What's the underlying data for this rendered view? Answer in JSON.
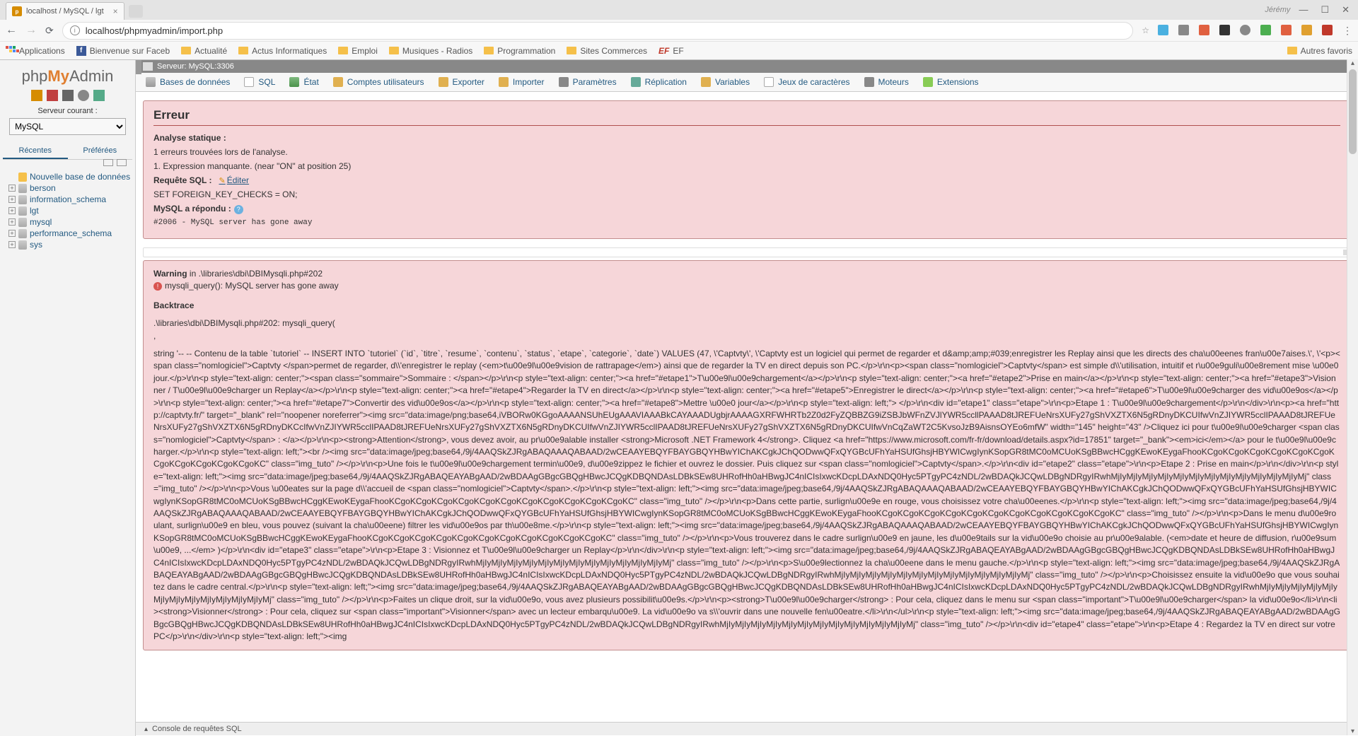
{
  "browser": {
    "tab_title": "localhost / MySQL / lgt",
    "user": "Jérémy",
    "url": "localhost/phpmyadmin/import.php"
  },
  "bookmarks": {
    "apps": "Applications",
    "fb": "Bienvenue sur Faceb",
    "actu": "Actualité",
    "actuinfo": "Actus Informatiques",
    "emploi": "Emploi",
    "musique": "Musiques - Radios",
    "prog": "Programmation",
    "sites": "Sites Commerces",
    "ef": "EF",
    "other": "Autres favoris"
  },
  "sidebar": {
    "server_label": "Serveur courant :",
    "server_value": "MySQL",
    "tab_recent": "Récentes",
    "tab_pref": "Préférées",
    "new_db": "Nouvelle base de données",
    "dbs": [
      "berson",
      "information_schema",
      "lgt",
      "mysql",
      "performance_schema",
      "sys"
    ]
  },
  "topbar": {
    "server": "Serveur: MySQL:3306"
  },
  "menu": {
    "db": "Bases de données",
    "sql": "SQL",
    "etat": "État",
    "users": "Comptes utilisateurs",
    "export": "Exporter",
    "import": "Importer",
    "param": "Paramètres",
    "repl": "Réplication",
    "vars": "Variables",
    "charset": "Jeux de caractères",
    "engine": "Moteurs",
    "ext": "Extensions"
  },
  "error": {
    "title": "Erreur",
    "analysis": "Analyse statique :",
    "found": "1 erreurs trouvées lors de l'analyse.",
    "item": "Expression manquante. (near \"ON\" at position 25)",
    "sql_label": "Requête SQL :",
    "edit": "Éditer",
    "sql": "SET FOREIGN_KEY_CHECKS = ON;",
    "mysql_label": "MySQL a répondu :",
    "code": "#2006 - MySQL server has gone away"
  },
  "warning": {
    "label": "Warning",
    "in": "in .\\libraries\\dbi\\DBIMysqli.php#202",
    "msg": "mysqli_query(): MySQL server has gone away",
    "bt_label": "Backtrace",
    "bt_line": ".\\libraries\\dbi\\DBIMysqli.php#202: mysqli_query(",
    "comma": ",",
    "dump": "string '-- -- Contenu de la table `tutoriel` -- INSERT INTO `tutoriel` (`id`, `titre`, `resume`, `contenu`, `status`, `etape`, `categorie`, `date`) VALUES (47, \\'Captvty\\', \\'Captvty est un logiciel qui permet de regarder et d&amp;amp;#039;enregistrer les Replay ainsi que les directs des cha\\u00eenes fran\\u00e7aises.\\', \\'<p><span class=\"nomlogiciel\">Captvty </span>permet de regarder, d\\\\'enregistrer le replay (<em>t\\u00e9l\\u00e9vision de rattrapage</em>) ainsi que de regarder la TV en direct depuis son PC.</p>\\r\\n<p><span class=\"nomlogiciel\">Captvty</span> est simple d\\\\'utilisation, intuitif et r\\u00e9guli\\u00e8rement mise \\u00e0 jour.</p>\\r\\n<p style=\"text-align: center;\"><span class=\"sommaire\">Sommaire : </span></p>\\r\\n<p style=\"text-align: center;\"><a href=\"#etape1\">T\\u00e9l\\u00e9chargement</a></p>\\r\\n<p style=\"text-align: center;\"><a href=\"#etape2\">Prise en main</a></p>\\r\\n<p style=\"text-align: center;\"><a href=\"#etape3\">Visionner / T\\u00e9l\\u00e9charger un Replay</a></p>\\r\\n<p style=\"text-align: center;\"><a href=\"#etape4\">Regarder la TV en direct</a></p>\\r\\n<p style=\"text-align: center;\"><a href=\"#etape5\">Enregistrer le direct</a></p>\\r\\n<p style=\"text-align: center;\"><a href=\"#etape6\">T\\u00e9l\\u00e9charger des vid\\u00e9os</a></p>\\r\\n<p style=\"text-align: center;\"><a href=\"#etape7\">Convertir des vid\\u00e9os</a></p>\\r\\n<p style=\"text-align: center;\"><a href=\"#etape8\">Mettre \\u00e0 jour</a></p>\\r\\n<p style=\"text-align: left;\"> </p>\\r\\n<div id=\"etape1\" class=\"etape\">\\r\\n<p>Etape 1 : T\\u00e9l\\u00e9chargement</p>\\r\\n</div>\\r\\n<p><a href=\"http://captvty.fr/\" target=\"_blank\" rel=\"noopener noreferrer\"><img src=\"data:image/png;base64,iVBORw0KGgoAAAANSUhEUgAAAVIAAABkCAYAAADUgbjrAAAAGXRFWHRTb2Z0d2FyZQBBZG9iZSBJbWFnZVJlYWR5ccllPAAAD8tJREFUeNrsXUFy27gShVXZTX6N5gRDnyDKCUIfwVnZJIYWR5cclIPAAAD8tJREFUeNrsXUFy27gShVXZTX6N5gRDnyDKCcIfwVnZJIYWR5cclIPAAD8tJREFUeNrsXUFy27gShVXZTX6N5gRDnyDKCUIfwVnZJIYWR5cclIPAAD8tJREFUeNrsXUFy27gShVXZTX6N5gRDnyDKCUIfwVnCqZaWT2C5KvsoJzB9AisnsOYEo6mfW\" width=\"145\" height=\"43\" />Cliquez ici pour t\\u00e9l\\u00e9charger <span class=\"nomlogiciel\">Captvty</span> : </a></p>\\r\\n<p><strong>Attention</strong>, vous devez avoir, au pr\\u00e9alable installer <strong>Microsoft .NET Framework 4</strong>. Cliquez <a href=\"https://www.microsoft.com/fr-fr/download/details.aspx?id=17851\" target=\"_bank\"><em>ici</em></a> pour le t\\u00e9l\\u00e9charger.</p>\\r\\n<p style=\"text-align: left;\"><br /><img src=\"data:image/jpeg;base64,/9j/4AAQSkZJRgABAQAAAQABAAD/2wCEAAYEBQYFBAYGBQYHBwYIChAKCgkJChQODwwQFxQYGBcUFhYaHSUfGhsjHBYWICwgIynKSopGR8tMC0oMCUoKSgBBwcHCggKEwoKEygaFhooKCgoKCgoKCgoKCgoKCgoKCgoKCgoKCgoKCgoKCgoKCgoKC\" class=\"img_tuto\" /></p>\\r\\n<p>Une fois le t\\u00e9l\\u00e9chargement termin\\u00e9, d\\u00e9zippez le fichier et ouvrez le dossier. Puis cliquez sur <span class=\"nomlogiciel\">Captvty</span>.</p>\\r\\n<div id=\"etape2\" class=\"etape\">\\r\\n<p>Etape 2 : Prise en main</p>\\r\\n</div>\\r\\n<p style=\"text-align: left;\"><img src=\"data:image/jpeg;base64,/9j/4AAQSkZJRgABAQEAYABgAAD/2wBDAAgGBgcGBQgHBwcJCQgKDBQNDAsLDBkSEw8UHRofHh0aHBwgJC4nICIsIxwcKDcpLDAxNDQ0Hyc5PTgyPC4zNDL/2wBDAQkJCQwLDBgNDRgyIRwhMjIyMjIyMjIyMjIyMjIyMjIyMjIyMjIyMjIyMjIyMjIyMjIyMj\" class=\"img_tuto\" /></p>\\r\\n<p>Vous \\u00eates sur la page d\\\\'accueil de <span class=\"nomlogiciel\">Captvty</span>.</p>\\r\\n<p style=\"text-align: left;\"><img src=\"data:image/jpeg;base64,/9j/4AAQSkZJRgABAQAAAQABAAD/2wCEAAYEBQYFBAYGBQYHBwYIChAKCgkJChQODwwQFxQYGBcUFhYaHSUfGhsjHBYWICwgIynKSopGR8tMC0oMCUoKSgBBwcHCggKEwoKEygaFhooKCgoKCgoKCgoKCgoKCgoKCgoKCgoKCgoKCgoKCgoKCgoKC\" class=\"img_tuto\" /></p>\\r\\n<p>Dans cette partie, surlign\\u00e9e en rouge, vous choisissez votre cha\\u00eenes.</p>\\r\\n<p style=\"text-align: left;\"><img src=\"data:image/jpeg;base64,/9j/4AAQSkZJRgABAQAAAQABAAD/2wCEAAYEBQYFBAYGBQYHBwYIChAKCgkJChQODwwQFxQYGBcUFhYaHSUfGhsjHBYWICwgIynKSopGR8tMC0oMCUoKSgBBwcHCggKEwoKEygaFhooKCgoKCgoKCgoKCgoKCgoKCgoKCgoKCgoKCgoKCgoKCgoKC\" class=\"img_tuto\" /></p>\\r\\n<p>Dans le menu d\\u00e9roulant, surlign\\u00e9 en bleu, vous pouvez (suivant la cha\\u00eene) filtrer les vid\\u00e9os par th\\u00e8me.</p>\\r\\n<p style=\"text-align: left;\"><img src=\"data:image/jpeg;base64,/9j/4AAQSkZJRgABAQAAAQABAAD/2wCEAAYEBQYFBAYGBQYHBwYIChAKCgkJChQODwwQFxQYGBcUFhYaHSUfGhsjHBYWICwgIynKSopGR8tMC0oMCUoKSgBBwcHCggKEwoKEygaFhooKCgoKCgoKCgoKCgoKCgoKCgoKCgoKCgoKCgoKCgoKCgoKC\" class=\"img_tuto\" /></p>\\r\\n<p>Vous trouverez dans le cadre surlign\\u00e9 en jaune, les d\\u00e9tails sur la vid\\u00e9o choisie au pr\\u00e9alable. (<em>date et heure de diffusion, r\\u00e9sum\\u00e9, ...</em> )</p>\\r\\n<div id=\"etape3\" class=\"etape\">\\r\\n<p>Etape 3 : Visionnez et T\\u00e9l\\u00e9charger un Replay</p>\\r\\n</div>\\r\\n<p style=\"text-align: left;\"><img src=\"data:image/jpeg;base64,/9j/4AAQSkZJRgABAQEAYABgAAD/2wBDAAgGBgcGBQgHBwcJCQgKDBQNDAsLDBkSEw8UHRofHh0aHBwgJC4nICIsIxwcKDcpLDAxNDQ0Hyc5PTgyPC4zNDL/2wBDAQkJCQwLDBgNDRgyIRwhMjIyMjIyMjIyMjIyMjIyMjIyMjIyMjIyMjIyMjIyMjIyMjIyMj\" class=\"img_tuto\" /></p>\\r\\n<p>S\\u00e9lectionnez la cha\\u00eene dans le menu gauche.</p>\\r\\n<p style=\"text-align: left;\"><img src=\"data:image/jpeg;base64,/9j/4AAQSkZJRgABAQEAYABgAAD/2wBDAAgGBgcGBQgHBwcJCQgKDBQNDAsLDBkSEw8UHRofHh0aHBwgJC4nICIsIxwcKDcpLDAxNDQ0Hyc5PTgyPC4zNDL/2wBDAQkJCQwLDBgNDRgyIRwhMjIyMjIyMjIyMjIyMjIyMjIyMjIyMjIyMjIyMjIyMjIyMjIyMj\" class=\"img_tuto\" /></p>\\r\\n<p>Choisissez ensuite la vid\\u00e9o que vous souhaitez dans le cadre central.</p>\\r\\n<p style=\"text-align: left;\"><img src=\"data:image/jpeg;base64,/9j/4AAQSkZJRgABAQEAYABgAAD/2wBDAAgGBgcGBQgHBwcJCQgKDBQNDAsLDBkSEw8UHRofHh0aHBwgJC4nICIsIxwcKDcpLDAxNDQ0Hyc5PTgyPC4zNDL/2wBDAQkJCQwLDBgNDRgyIRwhMjIyMjIyMjIyMjIyMjIyMjIyMjIyMjIyMjIyMjIyMjIyMjIyMj\" class=\"img_tuto\" /></p>\\r\\n<p>Faites un clique droit, sur la vid\\u00e9o, vous avez plusieurs possibilit\\u00e9s.</p>\\r\\n<p><strong>T\\u00e9l\\u00e9charger</strong> : Pour cela, cliquez dans le menu sur <span class=\"important\">T\\u00e9l\\u00e9charger</span> la vid\\u00e9o</li>\\r\\n<li><strong>Visionner</strong> : Pour cela, cliquez sur <span class=\"important\">Visionner</span> avec un lecteur embarqu\\u00e9. La vid\\u00e9o va s\\\\'ouvrir dans une nouvelle fen\\u00eatre.</li>\\r\\n</ul>\\r\\n<p style=\"text-align: left;\"><img src=\"data:image/jpeg;base64,/9j/4AAQSkZJRgABAQEAYABgAAD/2wBDAAgGBgcGBQgHBwcJCQgKDBQNDAsLDBkSEw8UHRofHh0aHBwgJC4nICIsIxwcKDcpLDAxNDQ0Hyc5PTgyPC4zNDL/2wBDAQkJCQwLDBgNDRgyIRwhMjIyMjIyMjIyMjIyMjIyMjIyMjIyMjIyMjIyMjIyMjIyMjIyMj\" class=\"img_tuto\" /></p>\\r\\n<div id=\"etape4\" class=\"etape\">\\r\\n<p>Etape 4 : Regardez la TV en direct sur votre PC</p>\\r\\n</div>\\r\\n<p style=\"text-align: left;\"><img"
  },
  "console": "Console de requêtes SQL"
}
